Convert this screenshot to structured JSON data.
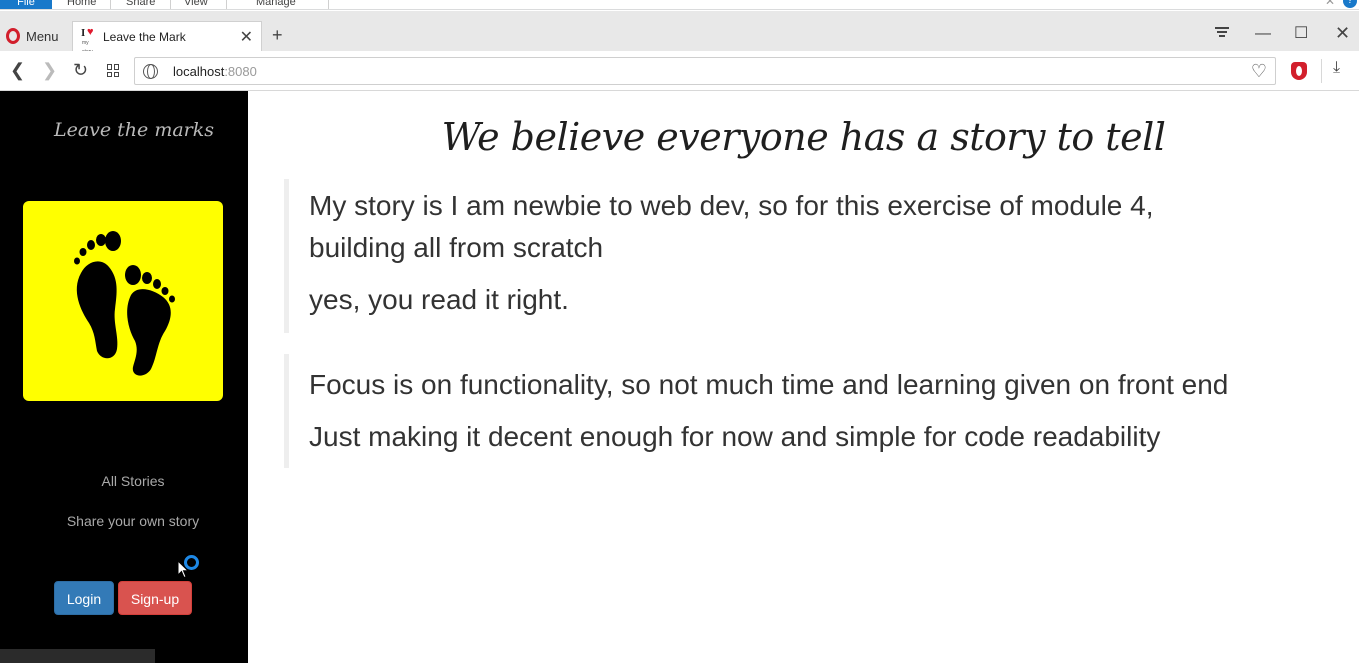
{
  "ribbon": {
    "file": "File",
    "tabs": [
      "Home",
      "Share",
      "View",
      "Manage"
    ]
  },
  "browser": {
    "menu_label": "Menu",
    "tab_title": "Leave the Mark",
    "url_host": "localhost",
    "url_port": ":8080",
    "accent_color": "#d21f2c"
  },
  "sidebar": {
    "brand": "Leave the marks",
    "logo_bg": "#ffff00",
    "nav": [
      "All Stories",
      "Share your own story"
    ],
    "login_label": "Login",
    "signup_label": "Sign-up"
  },
  "main": {
    "heading": "We believe everyone has a story to tell",
    "quotes": [
      {
        "lines": [
          "My story is I am newbie to web dev, so for this exercise of module 4, building all from scratch",
          "yes, you read it right."
        ]
      },
      {
        "lines": [
          "Focus is on functionality, so not much time and learning given on front end",
          "Just making it decent enough for now and simple for code readability"
        ]
      }
    ]
  }
}
